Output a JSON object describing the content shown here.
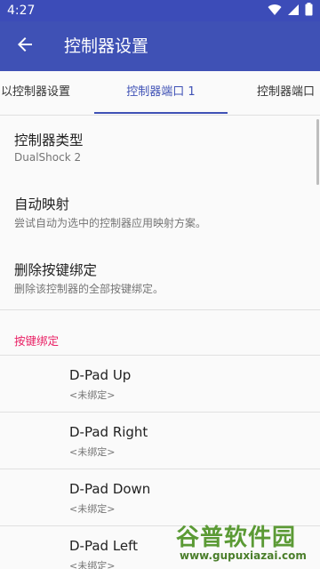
{
  "status_bar": {
    "time": "4:27",
    "icons": [
      "wifi-icon",
      "cellular-icon",
      "battery-icon"
    ]
  },
  "app_bar": {
    "back_icon": "arrow-back-icon",
    "title": "控制器设置",
    "color": "#3f51b5"
  },
  "tabs": [
    {
      "label": "以控制器设置",
      "active": false
    },
    {
      "label": "控制器端口 1",
      "active": true
    },
    {
      "label": "控制器端口",
      "active": false
    }
  ],
  "preferences": [
    {
      "title": "控制器类型",
      "summary": "DualShock 2"
    },
    {
      "title": "自动映射",
      "summary": "尝试自动为选中的控制器应用映射方案。"
    },
    {
      "title": "删除按键绑定",
      "summary": "删除该控制器的全部按键绑定。"
    }
  ],
  "bindings_section": {
    "header": "按键绑定",
    "header_color": "#e91e63",
    "items": [
      {
        "name": "D-Pad Up",
        "value": "<未绑定>"
      },
      {
        "name": "D-Pad Right",
        "value": "<未绑定>"
      },
      {
        "name": "D-Pad Down",
        "value": "<未绑定>"
      },
      {
        "name": "D-Pad Left",
        "value": "<未绑定>"
      }
    ]
  },
  "watermark": {
    "main": "谷普软件园",
    "url": "www.gupuxiazai.com"
  }
}
